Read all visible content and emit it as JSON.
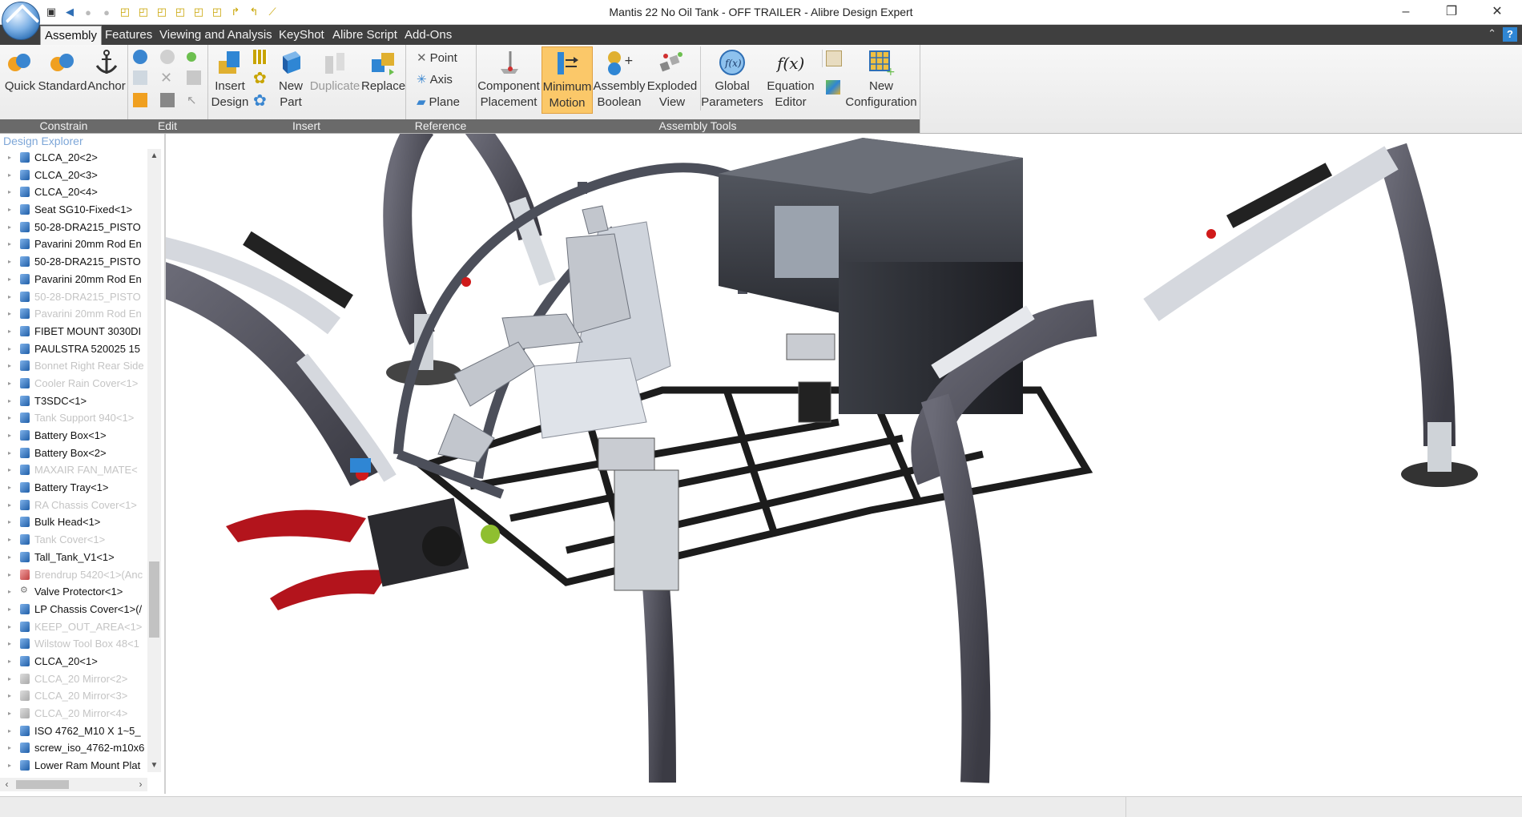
{
  "window": {
    "title": "Mantis 22 No Oil Tank - OFF TRAILER - Alibre Design Expert",
    "minimize": "–",
    "restore": "❐",
    "close": "✕"
  },
  "quick_access": [
    "save-icon",
    "undo-icon",
    "redo-icon",
    "circle-icon",
    "cube-icon",
    "cube-icon",
    "cube-icon",
    "cube-icon",
    "cube-icon",
    "cube-icon",
    "arrow-icon",
    "arrow-icon",
    "line-icon"
  ],
  "menu_tabs": [
    "Assembly",
    "Features",
    "Viewing and Analysis",
    "KeyShot",
    "Alibre Script",
    "Add-Ons"
  ],
  "help_label": "?",
  "ribbon": {
    "constrain": {
      "label": "Constrain",
      "quick": "Quick",
      "standard": "Standard",
      "anchor": "Anchor"
    },
    "edit": {
      "label": "Edit"
    },
    "insert": {
      "label": "Insert",
      "insert_design": [
        "Insert",
        "Design"
      ],
      "new_part": [
        "New",
        "Part"
      ],
      "duplicate": "Duplicate",
      "replace": "Replace"
    },
    "reference": {
      "label": "Reference",
      "point": "Point",
      "axis": "Axis",
      "plane": "Plane"
    },
    "assembly_tools": {
      "label": "Assembly Tools",
      "component_placement": [
        "Component",
        "Placement"
      ],
      "minimum_motion": [
        "Minimum",
        "Motion"
      ],
      "assembly_boolean": [
        "Assembly",
        "Boolean"
      ],
      "exploded_view": [
        "Exploded",
        "View"
      ],
      "global_parameters": [
        "Global",
        "Parameters"
      ],
      "equation_editor": [
        "Equation",
        "Editor"
      ],
      "new_configuration": [
        "New",
        "Configuration"
      ]
    }
  },
  "explorer": {
    "title": "Design Explorer",
    "items": [
      {
        "label": "CLCA_20<2>",
        "dim": false,
        "icon": "clca"
      },
      {
        "label": "CLCA_20<3>",
        "dim": false,
        "icon": "clca"
      },
      {
        "label": "CLCA_20<4>",
        "dim": false,
        "icon": "clca"
      },
      {
        "label": "Seat SG10-Fixed<1>",
        "dim": false,
        "icon": "part"
      },
      {
        "label": "50-28-DRA215_PISTO",
        "dim": false,
        "icon": "part"
      },
      {
        "label": "Pavarini 20mm Rod En",
        "dim": false,
        "icon": "part"
      },
      {
        "label": "50-28-DRA215_PISTO",
        "dim": false,
        "icon": "part"
      },
      {
        "label": "Pavarini 20mm Rod En",
        "dim": false,
        "icon": "part"
      },
      {
        "label": "50-28-DRA215_PISTO",
        "dim": true,
        "icon": "part"
      },
      {
        "label": "Pavarini 20mm Rod En",
        "dim": true,
        "icon": "part"
      },
      {
        "label": "FIBET MOUNT 3030DI",
        "dim": false,
        "icon": "part"
      },
      {
        "label": "PAULSTRA 520025 15",
        "dim": false,
        "icon": "part"
      },
      {
        "label": "Bonnet Right Rear Side",
        "dim": true,
        "icon": "part"
      },
      {
        "label": "Cooler Rain Cover<1>",
        "dim": true,
        "icon": "part"
      },
      {
        "label": "T3SDC<1>",
        "dim": false,
        "icon": "part"
      },
      {
        "label": "Tank Support 940<1>",
        "dim": true,
        "icon": "part"
      },
      {
        "label": "Battery Box<1>",
        "dim": false,
        "icon": "part"
      },
      {
        "label": "Battery Box<2>",
        "dim": false,
        "icon": "part"
      },
      {
        "label": "MAXAIR FAN_MATE<",
        "dim": true,
        "icon": "part"
      },
      {
        "label": "Battery Tray<1>",
        "dim": false,
        "icon": "part"
      },
      {
        "label": "RA Chassis Cover<1>",
        "dim": true,
        "icon": "part"
      },
      {
        "label": "Bulk Head<1>",
        "dim": false,
        "icon": "part"
      },
      {
        "label": "Tank Cover<1>",
        "dim": true,
        "icon": "part"
      },
      {
        "label": "Tall_Tank_V1<1>",
        "dim": false,
        "icon": "part"
      },
      {
        "label": "Brendrup 5420<1>(Anc",
        "dim": true,
        "icon": "red"
      },
      {
        "label": "Valve Protector<1>",
        "dim": false,
        "icon": "valve"
      },
      {
        "label": "LP Chassis Cover<1>(/",
        "dim": false,
        "icon": "part"
      },
      {
        "label": "KEEP_OUT_AREA<1>",
        "dim": true,
        "icon": "part"
      },
      {
        "label": "Wilstow Tool Box 48<1",
        "dim": true,
        "icon": "part"
      },
      {
        "label": "CLCA_20<1>",
        "dim": false,
        "icon": "clca"
      },
      {
        "label": "CLCA_20 Mirror<2>",
        "dim": true,
        "icon": "gray"
      },
      {
        "label": "CLCA_20 Mirror<3>",
        "dim": true,
        "icon": "gray"
      },
      {
        "label": "CLCA_20 Mirror<4>",
        "dim": true,
        "icon": "gray"
      },
      {
        "label": "ISO 4762_M10 X 1~5_",
        "dim": false,
        "icon": "part"
      },
      {
        "label": "screw_iso_4762-m10x6",
        "dim": false,
        "icon": "part"
      },
      {
        "label": "Lower Ram Mount Plat",
        "dim": false,
        "icon": "part"
      }
    ]
  },
  "viewport": {
    "model_name": "Mantis 22 No Oil Tank"
  },
  "colors": {
    "tabbar_bg": "#3f3f3f",
    "group_label_bg": "#6a6a6a",
    "highlight": "#fbc869",
    "leg_dark": "#4b4b55",
    "leg_light": "#d5d8de",
    "claw_red": "#b3141c",
    "frame_black": "#1c1c1c"
  }
}
